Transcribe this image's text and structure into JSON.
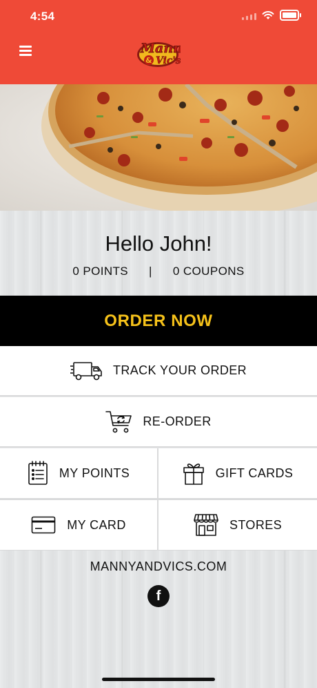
{
  "status_bar": {
    "time": "4:54"
  },
  "header": {
    "logo_text_top": "Manny",
    "logo_text_bottom": "& Vic's"
  },
  "greeting": {
    "hello": "Hello John!",
    "points": "0 POINTS",
    "separator": "|",
    "coupons": "0 COUPONS"
  },
  "order_now": {
    "label": "ORDER NOW"
  },
  "menu": {
    "track": "TRACK YOUR ORDER",
    "reorder": "RE-ORDER",
    "my_points": "MY POINTS",
    "gift_cards": "GIFT CARDS",
    "my_card": "MY CARD",
    "stores": "STORES"
  },
  "footer": {
    "website": "MANNYANDVICS.COM",
    "facebook_glyph": "f"
  },
  "colors": {
    "header": "#ef4a37",
    "order_bar": "#000000",
    "order_text": "#f6c21a"
  }
}
